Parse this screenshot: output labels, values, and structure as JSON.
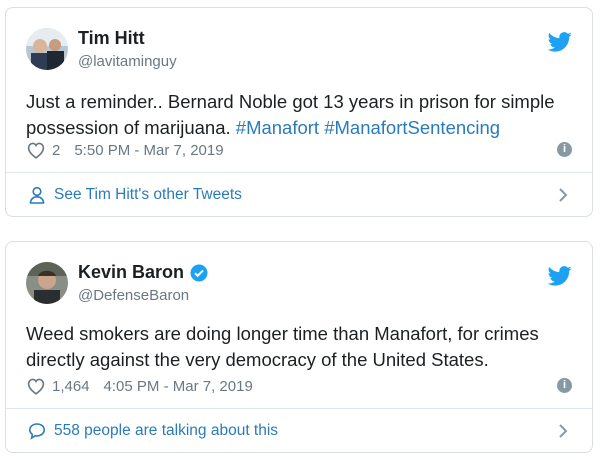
{
  "tweets": [
    {
      "name": "Tim Hitt",
      "handle": "@lavitaminguy",
      "verified": false,
      "text_before": "Just a reminder.. Bernard Noble got 13 years in prison for simple possession of marijuana. ",
      "hashtag1": "#Manafort",
      "hashtag2": "#ManafortSentencing",
      "likes": "2",
      "timestamp": "5:50 PM - Mar 7, 2019",
      "footer_text": "See Tim Hitt's other Tweets",
      "footer_icon": "user-icon"
    },
    {
      "name": "Kevin Baron",
      "handle": "@DefenseBaron",
      "verified": true,
      "text": "Weed smokers are doing longer time than Manafort, for crimes directly against the very democracy of the United States.",
      "likes": "1,464",
      "timestamp": "4:05 PM - Mar 7, 2019",
      "footer_text": "558 people are talking about this",
      "footer_icon": "speech-bubble-icon"
    }
  ],
  "info_glyph": "i",
  "colors": {
    "link": "#2b7bb9",
    "twitter_blue": "#1da1f2",
    "muted": "#697882",
    "text": "#1c2022",
    "border": "#d9dfe4"
  }
}
